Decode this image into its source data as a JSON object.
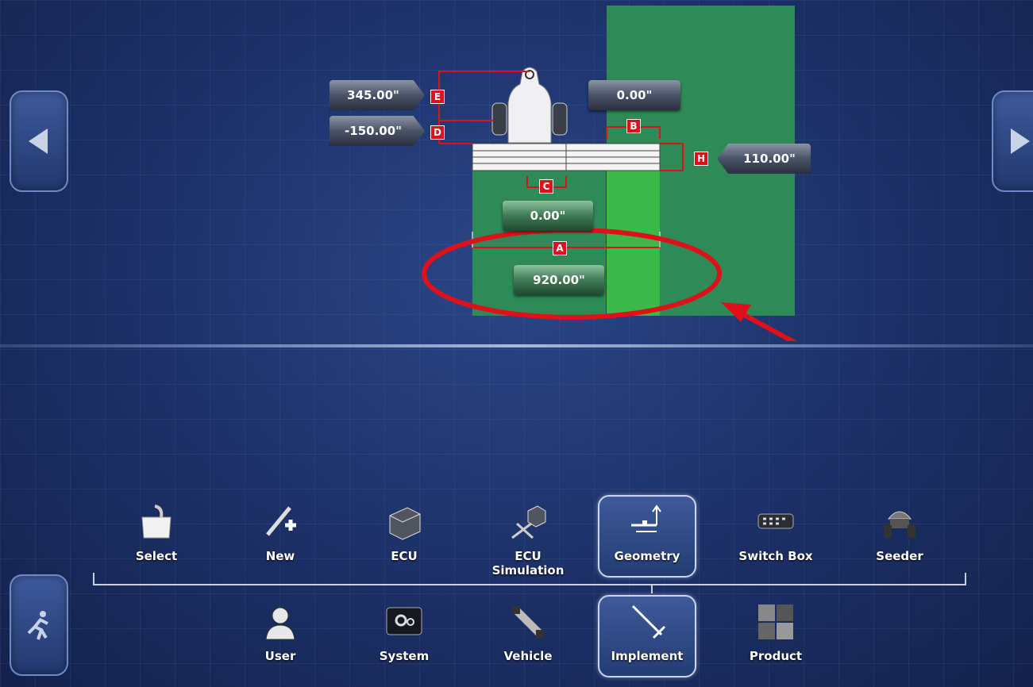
{
  "geometry": {
    "offset_e": "345.00\"",
    "offset_d": "-150.00\"",
    "offset_b": "0.00\"",
    "offset_h": "110.00\"",
    "offset_c": "0.00\"",
    "width_a": "920.00\"",
    "tags": {
      "a": "A",
      "b": "B",
      "c": "C",
      "d": "D",
      "e": "E",
      "h": "H"
    }
  },
  "upper_menu": [
    {
      "label": "Select",
      "icon": "folder-select-icon"
    },
    {
      "label": "New",
      "icon": "new-implement-icon"
    },
    {
      "label": "ECU",
      "icon": "ecu-icon"
    },
    {
      "label": "ECU Simulation",
      "icon": "ecu-simulation-icon"
    },
    {
      "label": "Geometry",
      "icon": "geometry-icon",
      "active": true
    },
    {
      "label": "Switch Box",
      "icon": "switch-box-icon"
    },
    {
      "label": "Seeder",
      "icon": "seeder-icon"
    }
  ],
  "lower_menu": [
    {
      "label": "User",
      "icon": "user-icon"
    },
    {
      "label": "System",
      "icon": "system-icon"
    },
    {
      "label": "Vehicle",
      "icon": "vehicle-icon"
    },
    {
      "label": "Implement",
      "icon": "implement-icon",
      "active": true
    },
    {
      "label": "Product",
      "icon": "product-icon"
    }
  ],
  "colors": {
    "annotation": "#e0101a",
    "field_dark": "#2e8a57",
    "field_light": "#3bb84a",
    "tag": "#e0101a"
  }
}
